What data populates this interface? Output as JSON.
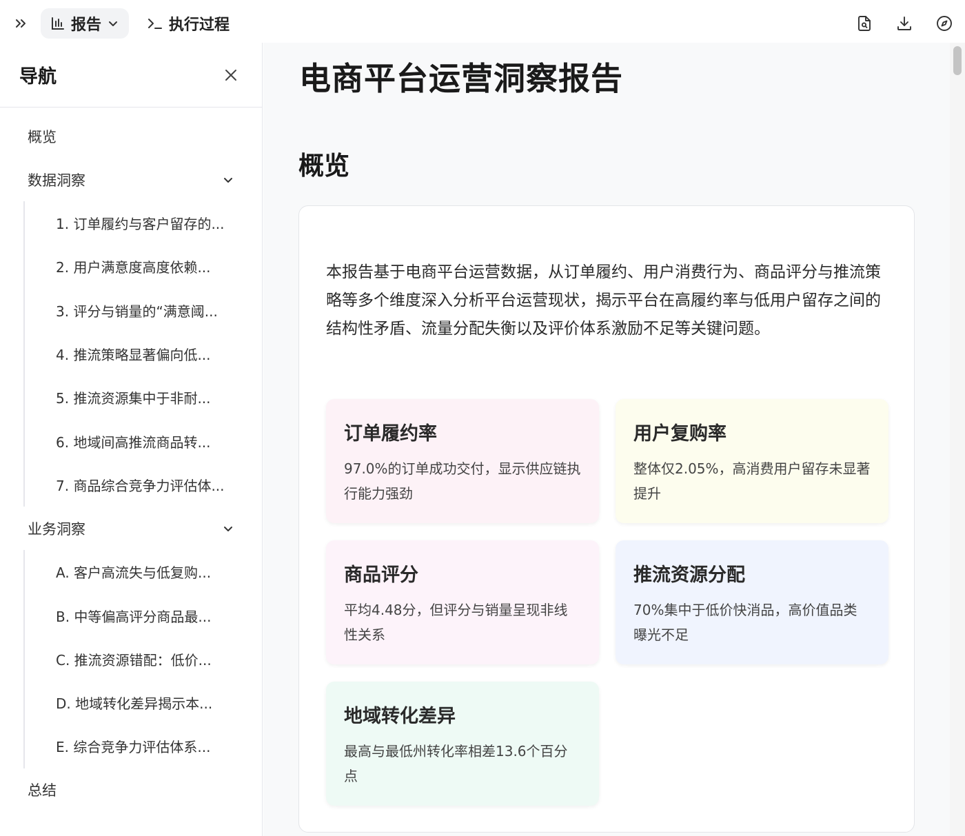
{
  "topbar": {
    "tabs": [
      {
        "label": "报告",
        "icon": "bar-chart-icon"
      },
      {
        "label": "执行过程",
        "icon": "terminal-icon"
      }
    ],
    "actions": [
      "file-search-icon",
      "download-icon",
      "compass-icon"
    ]
  },
  "sidebar": {
    "title": "导航",
    "overview": "概览",
    "groups": [
      {
        "label": "数据洞察",
        "items": [
          "1. 订单履约与客户留存的...",
          "2. 用户满意度高度依赖...",
          "3. 评分与销量的“满意阈...",
          "4. 推流策略显著偏向低...",
          "5. 推流资源集中于非耐...",
          "6. 地域间高推流商品转...",
          "7. 商品综合竞争力评估体..."
        ]
      },
      {
        "label": "业务洞察",
        "items": [
          "A. 客户高流失与低复购...",
          "B. 中等偏高评分商品最...",
          "C. 推流资源错配：低价...",
          "D. 地域转化差异揭示本...",
          "E. 综合竞争力评估体系..."
        ]
      }
    ],
    "summary": "总结"
  },
  "main": {
    "title": "电商平台运营洞察报告",
    "section_title": "概览",
    "intro": "本报告基于电商平台运营数据，从订单履约、用户消费行为、商品评分与推流策略等多个维度深入分析平台运营现状，揭示平台在高履约率与低用户留存之间的结构性矛盾、流量分配失衡以及评价体系激励不足等关键问题。",
    "metrics": [
      {
        "title": "订单履约率",
        "desc": "97.0%的订单成功交付，显示供应链执行能力强劲"
      },
      {
        "title": "用户复购率",
        "desc": "整体仅2.05%，高消费用户留存未显著提升"
      },
      {
        "title": "商品评分",
        "desc": "平均4.48分，但评分与销量呈现非线性关系"
      },
      {
        "title": "推流资源分配",
        "desc": "70%集中于低价快消品，高价值品类曝光不足"
      },
      {
        "title": "地域转化差异",
        "desc": "最高与最低州转化率相差13.6个百分点"
      }
    ]
  }
}
